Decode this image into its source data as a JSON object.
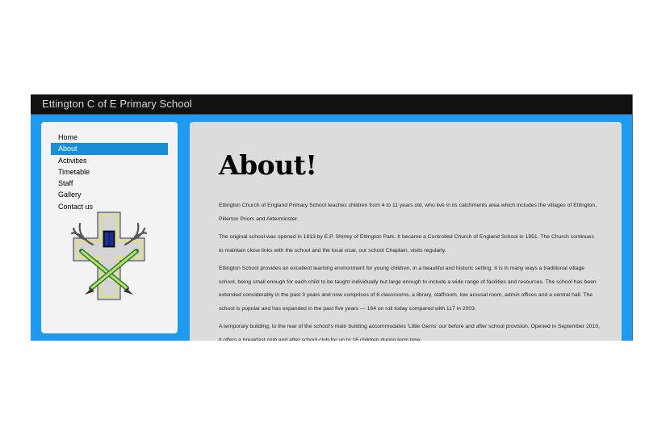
{
  "site": {
    "title": "Ettington C of E Primary School"
  },
  "nav": {
    "items": [
      {
        "label": "Home",
        "active": false
      },
      {
        "label": "About",
        "active": true
      },
      {
        "label": "Activities",
        "active": false
      },
      {
        "label": "Timetable",
        "active": false
      },
      {
        "label": "Staff",
        "active": false
      },
      {
        "label": "Gallery",
        "active": false
      },
      {
        "label": "Contact us",
        "active": false
      }
    ]
  },
  "logo": {
    "icon": "school-crest-cross-with-book-and-pencils"
  },
  "main": {
    "title": "About!",
    "paragraphs": [
      "Ettington Church of England Primary School teaches children from 4 to 11 years old, who live in its catchments area which includes the villages of Ettington, Pillerton Priors and Alderminster.",
      "The original school was opened in 1813 by E.P. Shirley of Ettington Park. It became a Controlled Church of England School in 1951. The Church continues to maintain close links with the school and the local vicar, our school Chaplain, visits regularly.",
      "Ettington School provides an excellent learning environment for young children, in a beautiful and historic setting. It is in many ways a traditional village school, being small enough for each child to be taught individually but large enough to include a wide range of facilities and resources. The school has been extended considerably in the past 3 years and now comprises of 6 classrooms, a library, staffroom, low arousal room, admin offices and a central hall. The school is popular and has expanded in the past five years — 164 on roll today compared with 117 in 2003.",
      "A temporary building, to the rear of the school's main building accommodates 'Little Gems' our before and after school provision. Opened in September 2010, it offers a breakfast club and after school club for up to 16 children during term time."
    ]
  },
  "colors": {
    "frame": "#1f9af3",
    "titlebar": "#111111",
    "active_nav": "#1b8dd6",
    "content_bg": "#dcdcdc"
  }
}
